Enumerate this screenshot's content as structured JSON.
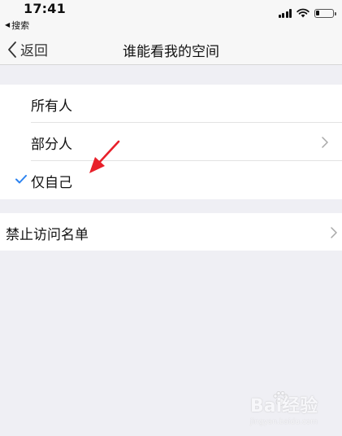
{
  "status_bar": {
    "time": "17:41",
    "back_app": "搜索"
  },
  "nav": {
    "back_label": "返回",
    "title": "谁能看我的空间"
  },
  "visibility_options": [
    {
      "label": "所有人",
      "checked": false,
      "has_chevron": false
    },
    {
      "label": "部分人",
      "checked": false,
      "has_chevron": true
    },
    {
      "label": "仅自己",
      "checked": true,
      "has_chevron": false
    }
  ],
  "block_list": {
    "label": "禁止访问名单"
  },
  "colors": {
    "check": "#2c83f0",
    "annotation_arrow": "#e8202a",
    "background": "#efeff4"
  },
  "watermark": {
    "brand": "Bai经验",
    "url": "jingyan.baidu.com"
  }
}
